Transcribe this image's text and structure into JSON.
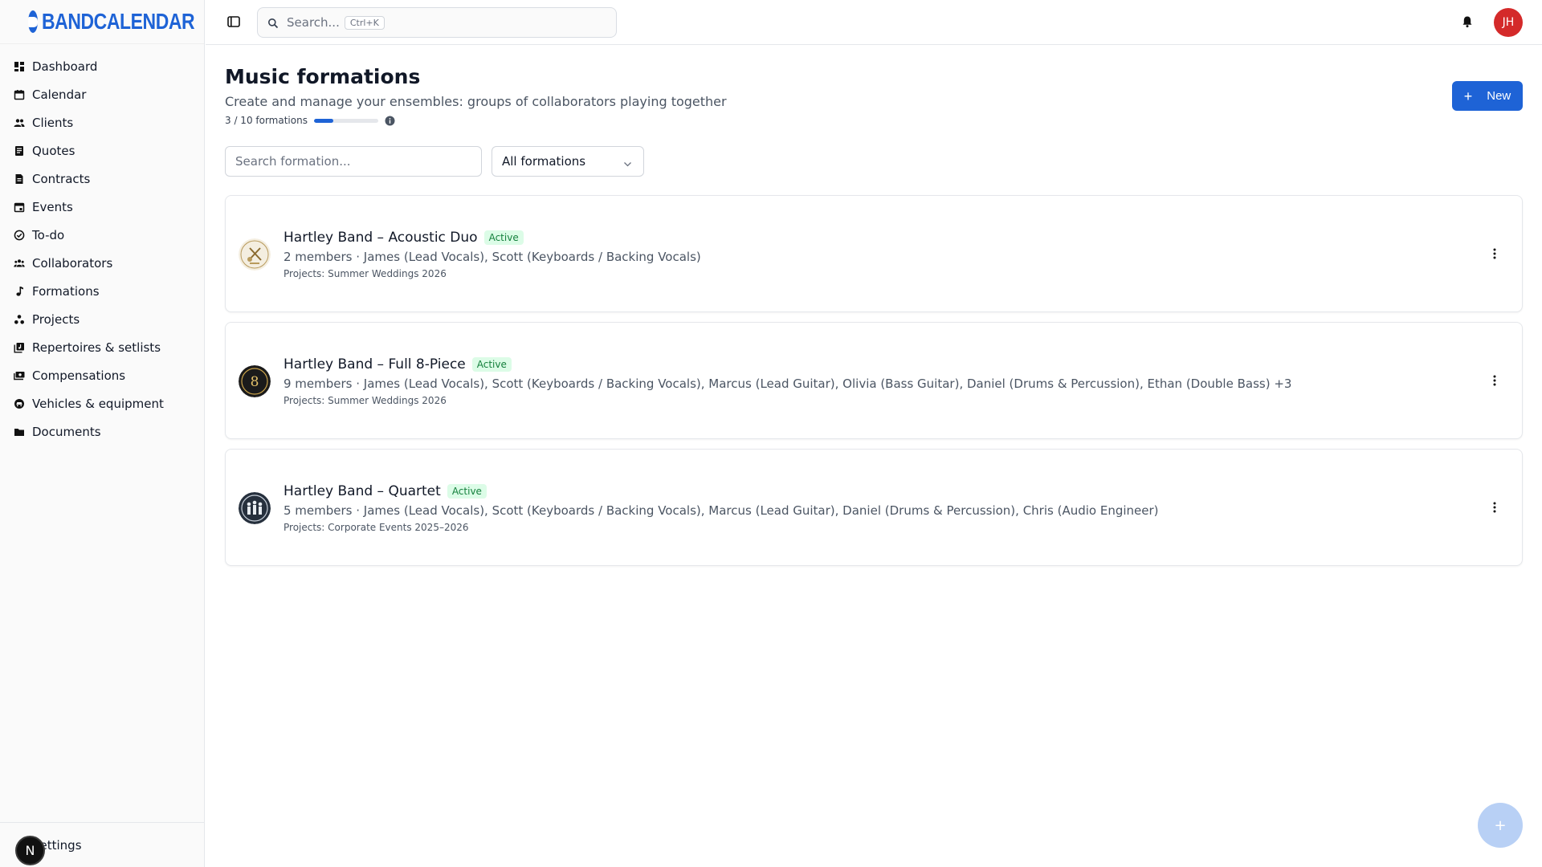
{
  "app": {
    "brand": "BANDCALENDAR"
  },
  "sidebar": {
    "items": [
      {
        "label": "Dashboard",
        "icon": "dashboard-icon"
      },
      {
        "label": "Calendar",
        "icon": "calendar-icon"
      },
      {
        "label": "Clients",
        "icon": "clients-icon"
      },
      {
        "label": "Quotes",
        "icon": "quotes-icon"
      },
      {
        "label": "Contracts",
        "icon": "contracts-icon"
      },
      {
        "label": "Events",
        "icon": "events-icon"
      },
      {
        "label": "To-do",
        "icon": "todo-icon"
      },
      {
        "label": "Collaborators",
        "icon": "collaborators-icon"
      },
      {
        "label": "Formations",
        "icon": "music-note-icon"
      },
      {
        "label": "Projects",
        "icon": "projects-icon"
      },
      {
        "label": "Repertoires & setlists",
        "icon": "repertoire-icon"
      },
      {
        "label": "Compensations",
        "icon": "compensations-icon"
      },
      {
        "label": "Vehicles & equipment",
        "icon": "vehicles-icon"
      },
      {
        "label": "Documents",
        "icon": "folder-icon"
      }
    ],
    "settings_label": "Settings",
    "n_badge": "N"
  },
  "topbar": {
    "search_placeholder": "Search...",
    "search_shortcut": "Ctrl+K",
    "avatar_initials": "JH"
  },
  "page": {
    "title": "Music formations",
    "subtitle": "Create and manage your ensembles: groups of collaborators playing together",
    "quota_label": "3 / 10 formations",
    "quota_fraction": 0.3,
    "new_button": "New",
    "search_placeholder": "Search formation...",
    "filter_value": "All formations"
  },
  "formations": [
    {
      "name": "Hartley Band – Acoustic Duo",
      "status": "Active",
      "members": "2 members · James (Lead Vocals), Scott (Keyboards / Backing Vocals)",
      "projects": "Projects: Summer Weddings 2026"
    },
    {
      "name": "Hartley Band – Full 8-Piece",
      "status": "Active",
      "members": "9 members · James (Lead Vocals), Scott (Keyboards / Backing Vocals), Marcus (Lead Guitar), Olivia (Bass Guitar), Daniel (Drums & Percussion), Ethan (Double Bass) +3",
      "projects": "Projects: Summer Weddings 2026"
    },
    {
      "name": "Hartley Band – Quartet",
      "status": "Active",
      "members": "5 members · James (Lead Vocals), Scott (Keyboards / Backing Vocals), Marcus (Lead Guitar), Daniel (Drums & Percussion), Chris (Audio Engineer)",
      "projects": "Projects: Corporate Events 2025–2026"
    }
  ],
  "colors": {
    "accent": "#1e63d6",
    "active_badge_bg": "#dcfce7",
    "active_badge_text": "#15803d",
    "avatar_bg": "#d42a2a"
  }
}
